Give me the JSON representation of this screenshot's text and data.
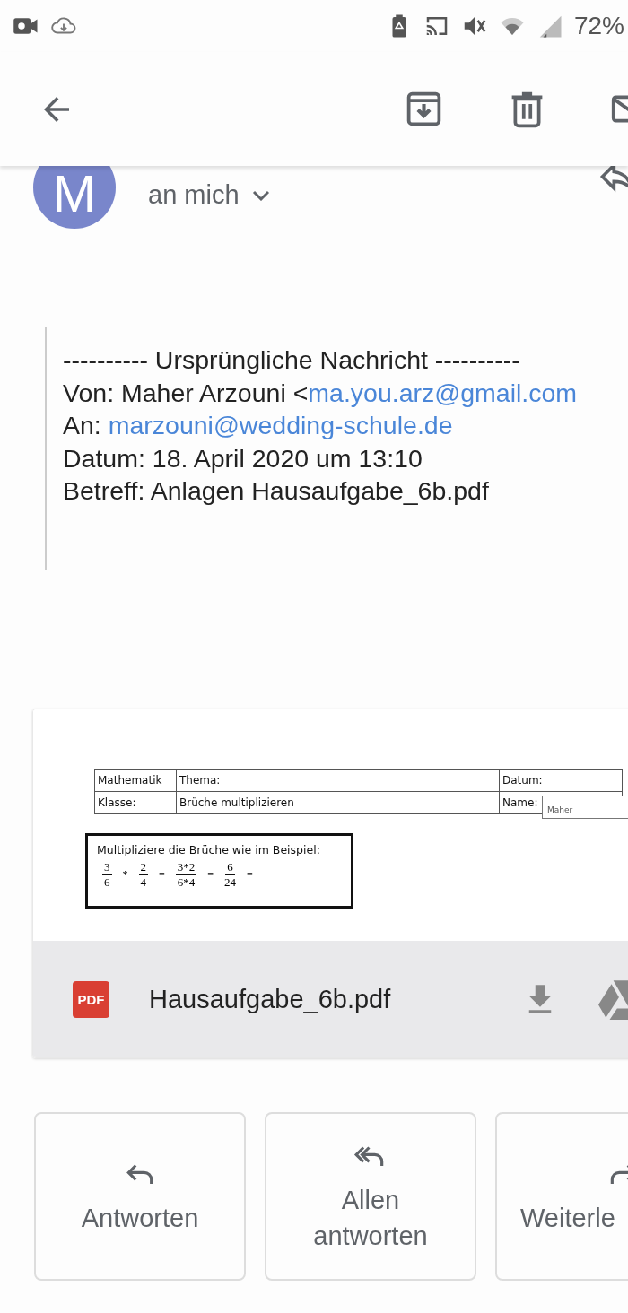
{
  "status_bar": {
    "battery": "72%"
  },
  "app_bar": {
    "actions": [
      {
        "kind": "archive"
      },
      {
        "kind": "delete"
      },
      {
        "kind": "mail"
      }
    ]
  },
  "message": {
    "avatar_letter": "M",
    "recipient": "an mich",
    "quoted_header": [
      {
        "text": "---------- Ursprüngliche Nachricht ----------"
      },
      {
        "text": "Von: Maher Arzouni <",
        "link": "ma.you.arz@gmail.com"
      },
      {
        "text": "An: ",
        "link": "marzouni@wedding-schule.de"
      },
      {
        "text": "Datum: 18. April 2020 um 13:10"
      },
      {
        "text": "Betreff: Anlagen Hausaufgabe_6b.pdf"
      }
    ]
  },
  "attachment": {
    "file_name": "Hausaufgabe_6b.pdf",
    "file_type": "PDF",
    "preview": {
      "table": [
        [
          "Mathematik",
          "Thema:",
          "Datum:"
        ],
        [
          "Klasse:",
          "Brüche multiplizieren",
          "Name:"
        ]
      ],
      "name_entry": "Maher",
      "exercise": "Multipliziere die Brüche wie im Beispiel:",
      "terms": [
        {
          "kind": "fraction",
          "num": "3",
          "den": "6"
        },
        {
          "kind": "operator",
          "text": "*"
        },
        {
          "kind": "fraction",
          "num": "2",
          "den": "4"
        },
        {
          "kind": "operator",
          "text": "="
        },
        {
          "kind": "fraction",
          "num": "3*2",
          "den": "6*4"
        },
        {
          "kind": "operator",
          "text": "="
        },
        {
          "kind": "fraction",
          "num": "6",
          "den": "24"
        },
        {
          "kind": "operator",
          "text": "="
        }
      ]
    }
  },
  "actions": [
    {
      "kind": "reply",
      "label": "Antworten"
    },
    {
      "kind": "reply_all",
      "label": "Allen antworten"
    },
    {
      "kind": "forward",
      "label": "Weiterle"
    }
  ]
}
